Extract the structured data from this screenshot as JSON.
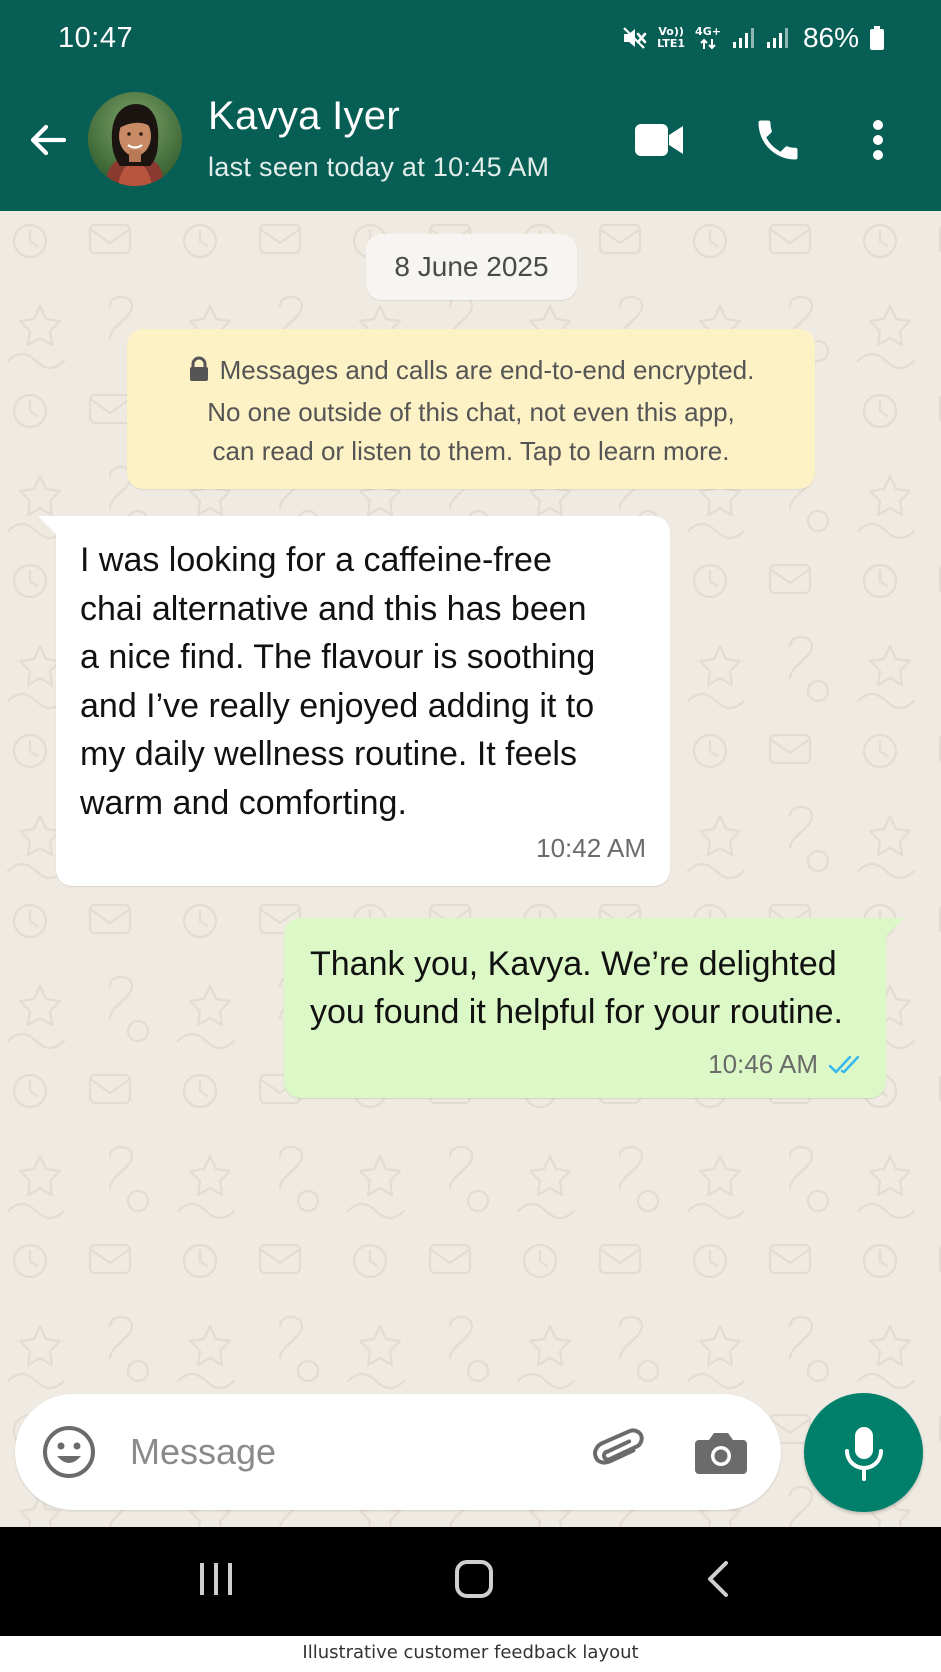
{
  "status_bar": {
    "time": "10:47",
    "volte_label_top": "Vo))",
    "volte_label_bottom": "LTE1",
    "network_label": "4G+",
    "battery": "86%",
    "icons": [
      "mute-icon",
      "volte-icon",
      "data-4g-icon",
      "signal-icon",
      "signal-icon",
      "battery-icon"
    ]
  },
  "header": {
    "contact_name": "Kavya Iyer",
    "last_seen": "last seen today at 10:45 AM",
    "icons": [
      "back-arrow-icon",
      "video-call-icon",
      "phone-icon",
      "more-vert-icon"
    ],
    "color": "#075e54"
  },
  "chat": {
    "date_chip": "8 June 2025",
    "encryption_notice": {
      "line1": "Messages and calls are end-to-end encrypted.",
      "line2": "No one outside of this chat, not even this app,",
      "line3": "can read or listen to them. Tap to learn more."
    },
    "messages": [
      {
        "direction": "incoming",
        "lines": [
          "I was looking for a caffeine-free",
          "chai alternative and this has been",
          "a nice find. The flavour is soothing",
          "and I’ve really enjoyed adding it to",
          "my daily wellness routine. It feels",
          "warm and comforting."
        ],
        "time": "10:42 AM"
      },
      {
        "direction": "outgoing",
        "lines": [
          "Thank you, Kavya. We’re delighted",
          "you found it helpful for your routine."
        ],
        "time": "10:46 AM",
        "status": "read",
        "status_icon": "double-check-icon",
        "bubble_color": "#dcf8c6"
      }
    ]
  },
  "composer": {
    "placeholder": "Message",
    "icons": [
      "emoji-icon",
      "attach-icon",
      "camera-icon",
      "mic-icon"
    ],
    "accent": "#00806a"
  },
  "nav_bar": {
    "icons": [
      "recents-icon",
      "home-icon",
      "nav-back-icon"
    ]
  },
  "caption": "Illustrative customer feedback layout"
}
